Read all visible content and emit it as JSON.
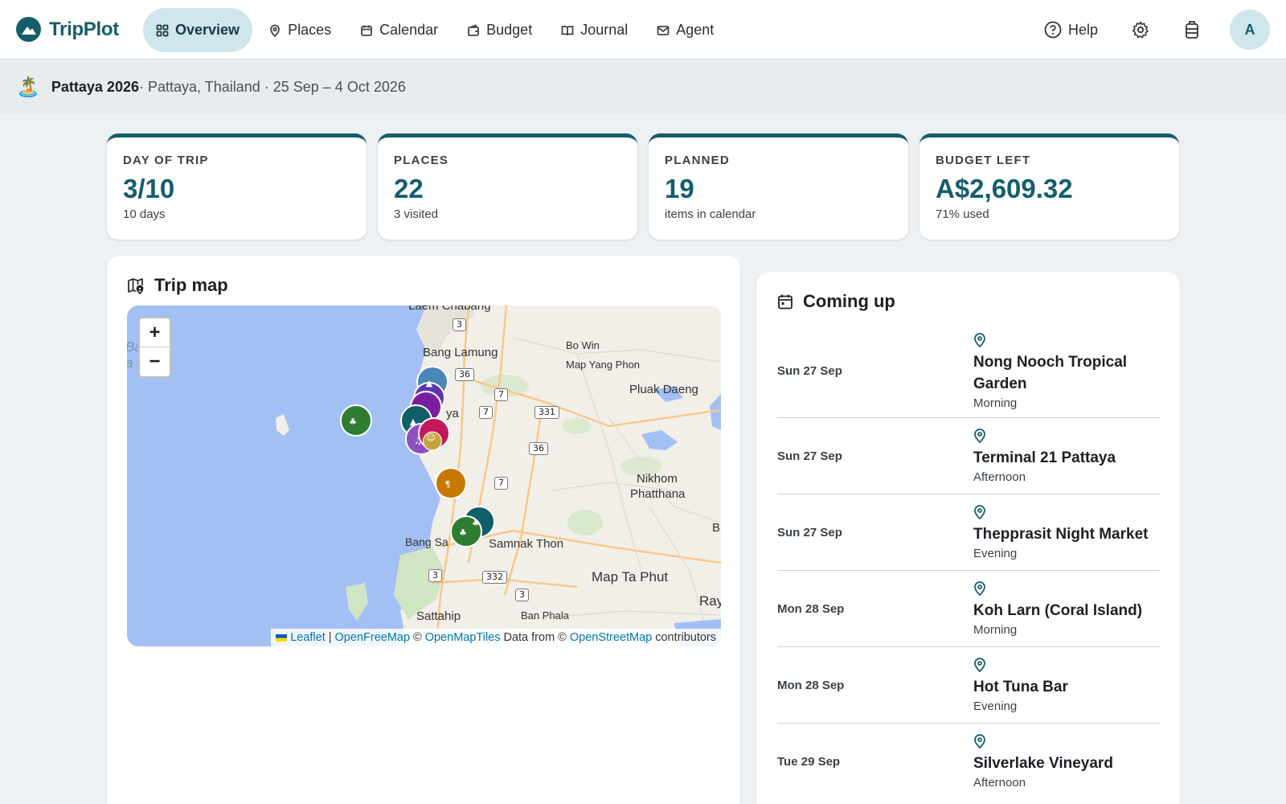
{
  "app": {
    "name": "TripPlot"
  },
  "nav": [
    {
      "label": "Overview",
      "icon": "grid-icon",
      "active": true
    },
    {
      "label": "Places",
      "icon": "pin-icon"
    },
    {
      "label": "Calendar",
      "icon": "calendar-icon"
    },
    {
      "label": "Budget",
      "icon": "wallet-icon"
    },
    {
      "label": "Journal",
      "icon": "book-icon"
    },
    {
      "label": "Agent",
      "icon": "mail-icon"
    }
  ],
  "header_tools": {
    "help_label": "Help",
    "avatar_initial": "A"
  },
  "trip": {
    "emoji": "🏝️",
    "name": "Pattaya 2026",
    "details": " · Pattaya, Thailand · 25 Sep – 4 Oct 2026"
  },
  "stats": [
    {
      "label": "DAY OF TRIP",
      "value": "3/10",
      "sub": "10 days"
    },
    {
      "label": "PLACES",
      "value": "22",
      "sub": "3 visited"
    },
    {
      "label": "PLANNED",
      "value": "19",
      "sub": "items in calendar"
    },
    {
      "label": "BUDGET LEFT",
      "value": "A$2,609.32",
      "sub": "71% used"
    }
  ],
  "map_card": {
    "title": "Trip map",
    "zoom_in": "+",
    "zoom_out": "−",
    "labels": {
      "bang_lamung": "Bang Lamung",
      "bo_win": "Bo Win",
      "map_yang_phon": "Map Yang Phon",
      "pluak_daeng": "Pluak Daeng",
      "nikhom": "Nikhom",
      "phatthana": "Phatthana",
      "samnak_thon": "Samnak Thon",
      "bang_sa": "Bang Sa",
      "map_ta_phut": "Map Ta Phut",
      "sattahip": "Sattahip",
      "ban_phala": "Ban Phala",
      "ray": "Ray",
      "ya": "ya",
      "bay_partial": "Ba  f",
      "bay_partial2": "a     k",
      "laem_chabang": "Laem Chabang",
      "b_edge": "B"
    },
    "road_shields": [
      "3",
      "36",
      "7",
      "7",
      "331",
      "36",
      "7",
      "3",
      "332",
      "3"
    ],
    "attribution": {
      "leaflet": "Leaflet",
      "sep": "|",
      "openfreemap": "OpenFreeMap",
      "copy1": "©",
      "openmaptiles": "OpenMapTiles",
      "data_from": "Data from ©",
      "osm": "OpenStreetMap",
      "contributors": "contributors"
    }
  },
  "coming_up": {
    "title": "Coming up",
    "items": [
      {
        "date": "Sun 27 Sep",
        "name": "Nong Nooch Tropical Garden",
        "time": "Morning"
      },
      {
        "date": "Sun 27 Sep",
        "name": "Terminal 21 Pattaya",
        "time": "Afternoon"
      },
      {
        "date": "Sun 27 Sep",
        "name": "Thepprasit Night Market",
        "time": "Evening"
      },
      {
        "date": "Mon 28 Sep",
        "name": "Koh Larn (Coral Island)",
        "time": "Morning"
      },
      {
        "date": "Mon 28 Sep",
        "name": "Hot Tuna Bar",
        "time": "Evening"
      },
      {
        "date": "Tue 29 Sep",
        "name": "Silverlake Vineyard",
        "time": "Afternoon"
      }
    ]
  },
  "colors": {
    "brand": "#155e6b",
    "nav_active_bg": "#cfe6ec",
    "sea": "#a3c0f5",
    "land": "#f2efe9"
  }
}
